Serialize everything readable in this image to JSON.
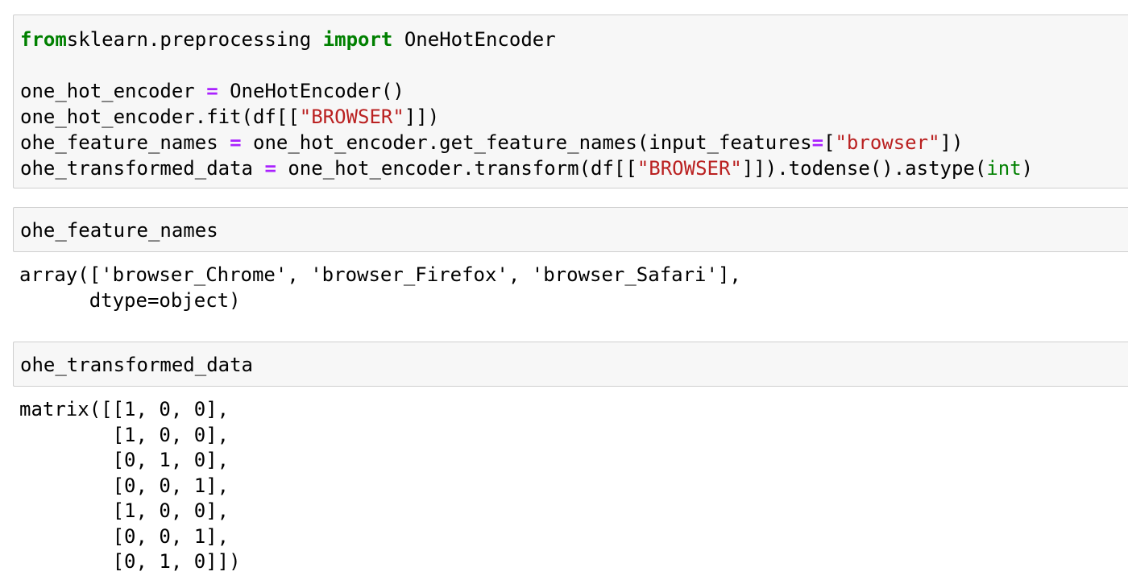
{
  "cells": [
    {
      "lines": [
        [
          [
            "kw",
            "from"
          ],
          [
            "",
            "sklearn.preprocessing "
          ],
          [
            "kw",
            "import"
          ],
          [
            "",
            " OneHotEncoder"
          ]
        ],
        [],
        [
          [
            "",
            "one_hot_encoder "
          ],
          [
            "op",
            "="
          ],
          [
            "",
            " OneHotEncoder()"
          ]
        ],
        [
          [
            "",
            "one_hot_encoder.fit(df[["
          ],
          [
            "str",
            "\"BROWSER\""
          ],
          [
            "",
            "]])"
          ]
        ],
        [
          [
            "",
            "ohe_feature_names "
          ],
          [
            "op",
            "="
          ],
          [
            "",
            " one_hot_encoder.get_feature_names(input_features"
          ],
          [
            "op",
            "="
          ],
          [
            "",
            "["
          ],
          [
            "str",
            "\"browser\""
          ],
          [
            "",
            "])"
          ]
        ],
        [
          [
            "",
            "ohe_transformed_data "
          ],
          [
            "op",
            "="
          ],
          [
            "",
            " one_hot_encoder.transform(df[["
          ],
          [
            "str",
            "\"BROWSER\""
          ],
          [
            "",
            "]]).todense().astype("
          ],
          [
            "bi",
            "int"
          ],
          [
            "",
            ")"
          ]
        ]
      ],
      "output": []
    },
    {
      "lines": [
        [
          [
            "",
            "ohe_feature_names"
          ]
        ]
      ],
      "output": [
        "array(['browser_Chrome', 'browser_Firefox', 'browser_Safari'],",
        "      dtype=object)"
      ]
    },
    {
      "lines": [
        [
          [
            "",
            "ohe_transformed_data"
          ]
        ]
      ],
      "output": [
        "matrix([[1, 0, 0],",
        "        [1, 0, 0],",
        "        [0, 1, 0],",
        "        [0, 0, 1],",
        "        [1, 0, 0],",
        "        [0, 0, 1],",
        "        [0, 1, 0]])"
      ]
    }
  ],
  "colors": {
    "keyword": "#008000",
    "operator": "#aa22ff",
    "string": "#ba2121",
    "builtin": "#008000",
    "cell_background": "#f7f7f7",
    "cell_border": "#cfcfcf"
  }
}
